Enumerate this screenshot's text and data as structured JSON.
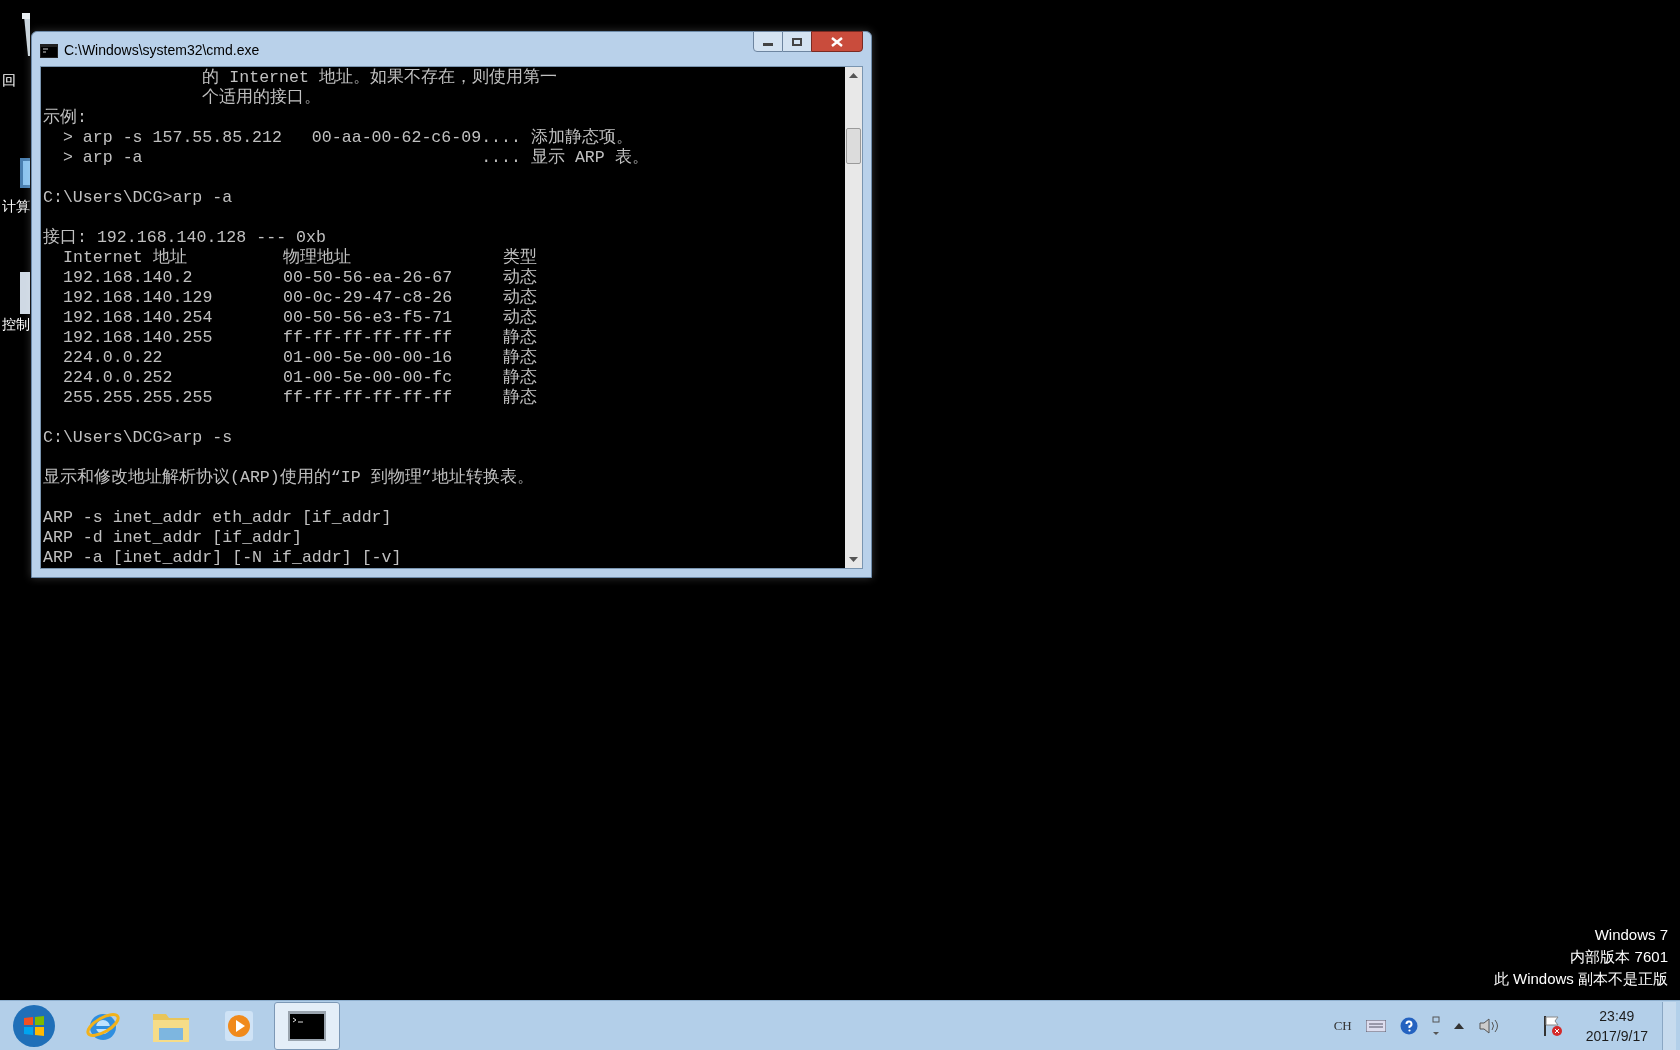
{
  "desktop_icons": [
    {
      "label": "回"
    },
    {
      "label": "计算"
    },
    {
      "label": "控制"
    }
  ],
  "window": {
    "title": "C:\\Windows\\system32\\cmd.exe",
    "console": [
      {
        "kind": "line",
        "text": "                的 Internet 地址。如果不存在，则使用第一"
      },
      {
        "kind": "line",
        "text": "                个适用的接口。"
      },
      {
        "kind": "line",
        "text": "示例:"
      },
      {
        "kind": "line",
        "text": "  > arp -s 157.55.85.212   00-aa-00-62-c6-09.... 添加静态项。"
      },
      {
        "kind": "line",
        "text": "  > arp -a                                  .... 显示 ARP 表。"
      },
      {
        "kind": "blank"
      },
      {
        "kind": "line",
        "text": "C:\\Users\\DCG>arp -a"
      },
      {
        "kind": "blank"
      },
      {
        "kind": "line",
        "text": "接口: 192.168.140.128 --- 0xb"
      },
      {
        "kind": "row",
        "cells": [
          "Internet 地址",
          "物理地址",
          "类型"
        ]
      },
      {
        "kind": "row",
        "cells": [
          "192.168.140.2",
          "00-50-56-ea-26-67",
          "动态"
        ]
      },
      {
        "kind": "row",
        "cells": [
          "192.168.140.129",
          "00-0c-29-47-c8-26",
          "动态"
        ]
      },
      {
        "kind": "row",
        "cells": [
          "192.168.140.254",
          "00-50-56-e3-f5-71",
          "动态"
        ]
      },
      {
        "kind": "row",
        "cells": [
          "192.168.140.255",
          "ff-ff-ff-ff-ff-ff",
          "静态"
        ]
      },
      {
        "kind": "row",
        "cells": [
          "224.0.0.22",
          "01-00-5e-00-00-16",
          "静态"
        ]
      },
      {
        "kind": "row",
        "cells": [
          "224.0.0.252",
          "01-00-5e-00-00-fc",
          "静态"
        ]
      },
      {
        "kind": "row",
        "cells": [
          "255.255.255.255",
          "ff-ff-ff-ff-ff-ff",
          "静态"
        ]
      },
      {
        "kind": "blank"
      },
      {
        "kind": "line",
        "text": "C:\\Users\\DCG>arp -s"
      },
      {
        "kind": "blank"
      },
      {
        "kind": "line",
        "text": "显示和修改地址解析协议(ARP)使用的“IP 到物理”地址转换表。"
      },
      {
        "kind": "blank"
      },
      {
        "kind": "line",
        "text": "ARP -s inet_addr eth_addr [if_addr]"
      },
      {
        "kind": "line",
        "text": "ARP -d inet_addr [if_addr]"
      },
      {
        "kind": "line",
        "text": "ARP -a [inet_addr] [-N if_addr] [-v]"
      }
    ]
  },
  "os_notice": [
    "Windows 7",
    "内部版本 7601",
    "此 Windows 副本不是正版"
  ],
  "taskbar": {
    "apps": [
      {
        "kind": "ie",
        "selected": false
      },
      {
        "kind": "folder",
        "selected": false
      },
      {
        "kind": "media",
        "selected": false
      },
      {
        "kind": "console",
        "selected": true
      }
    ],
    "language": "CH",
    "time": "23:49",
    "date": "2017/9/17"
  }
}
